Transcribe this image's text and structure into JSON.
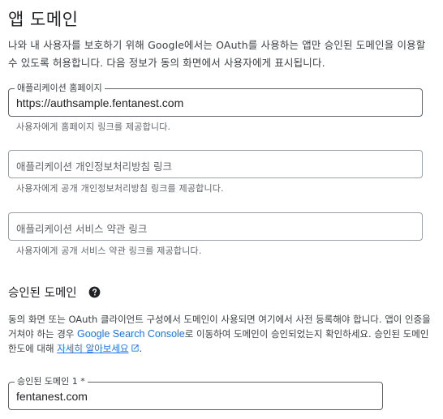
{
  "app_domain": {
    "title": "앱 도메인",
    "intro": "나와 내 사용자를 보호하기 위해 Google에서는 OAuth를 사용하는 앱만 승인된 도메인을 이용할 수 있도록 허용합니다. 다음 정보가 동의 화면에서 사용자에게 표시됩니다.",
    "homepage": {
      "label": "애플리케이션 홈페이지",
      "value": "https://authsample.fentanest.com",
      "helper": "사용자에게 홈페이지 링크를 제공합니다."
    },
    "privacy": {
      "placeholder": "애플리케이션 개인정보처리방침 링크",
      "helper": "사용자에게 공개 개인정보처리방침 링크를 제공합니다."
    },
    "terms": {
      "placeholder": "애플리케이션 서비스 약관 링크",
      "helper": "사용자에게 공개 서비스 약관 링크를 제공합니다."
    }
  },
  "authorized_domains": {
    "title": "승인된 도메인",
    "help_icon": "help-circle-icon",
    "desc_part1": "동의 화면 또는 OAuth 클라이언트 구성에서 도메인이 사용되면 여기에서 사전 등록해야 합니다. 앱이 인증을 거쳐야 하는 경우 ",
    "console_link": "Google Search Console",
    "desc_part2": "로 이동하여 도메인이 승인되었는지 확인하세요. 승인된 도메인 한도에 대해 ",
    "learn_more_link": "자세히 알아보세요",
    "desc_part3": ".",
    "external_icon": "external-link-icon",
    "domain1": {
      "label": "승인된 도메인 1 *",
      "value": "fentanest.com"
    }
  },
  "colors": {
    "link": "#1a73e8",
    "text": "#202124",
    "secondary_text": "#5f6368",
    "border": "#9aa0a6"
  }
}
